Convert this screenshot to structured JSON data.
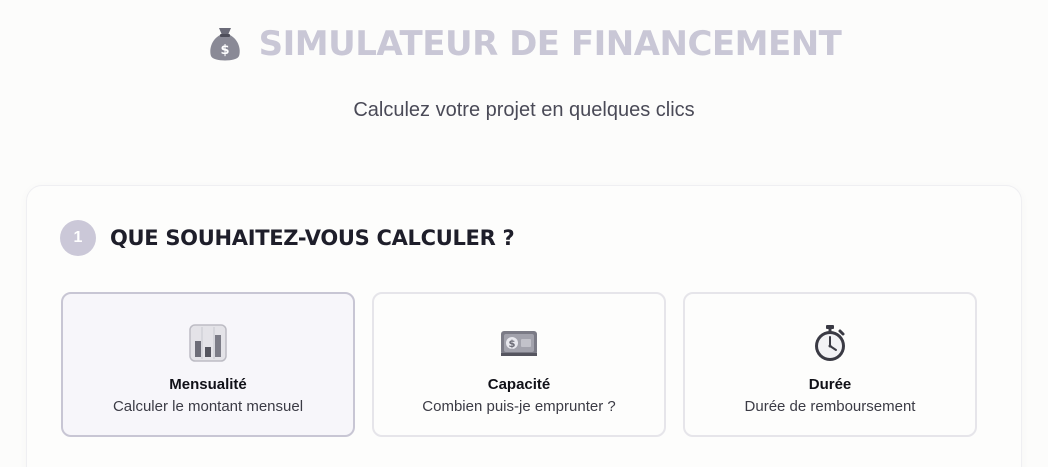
{
  "header": {
    "title": "SIMULATEUR DE FINANCEMENT",
    "title_icon": "money-bag-icon",
    "subtitle": "Calculez votre projet en quelques clics"
  },
  "step": {
    "number": "1",
    "title": "QUE SOUHAITEZ-VOUS CALCULER ?"
  },
  "options": [
    {
      "label": "Mensualité",
      "description": "Calculer le montant mensuel",
      "icon": "bar-chart-icon",
      "selected": true
    },
    {
      "label": "Capacité",
      "description": "Combien puis-je emprunter ?",
      "icon": "banknote-icon",
      "selected": false
    },
    {
      "label": "Durée",
      "description": "Durée de remboursement",
      "icon": "stopwatch-icon",
      "selected": false
    }
  ],
  "colors": {
    "title": "#c9c7d6",
    "badge": "#cbc8d8",
    "selected_border": "#c8c6d4",
    "selected_bg": "#f7f6fa"
  }
}
